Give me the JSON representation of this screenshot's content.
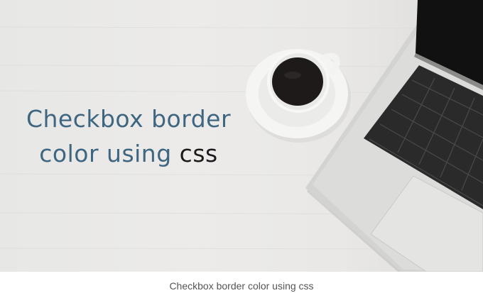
{
  "hero": {
    "line1": "Checkbox border",
    "line2_prefix": "color using",
    "line2_highlight": "css",
    "accent_color": "#3f6680",
    "highlight_color": "#1a1a1a"
  },
  "caption": "Checkbox border color using css",
  "photo": {
    "objects": [
      "coffee-cup",
      "saucer",
      "laptop",
      "keyboard",
      "trackpad",
      "desk-surface"
    ]
  }
}
